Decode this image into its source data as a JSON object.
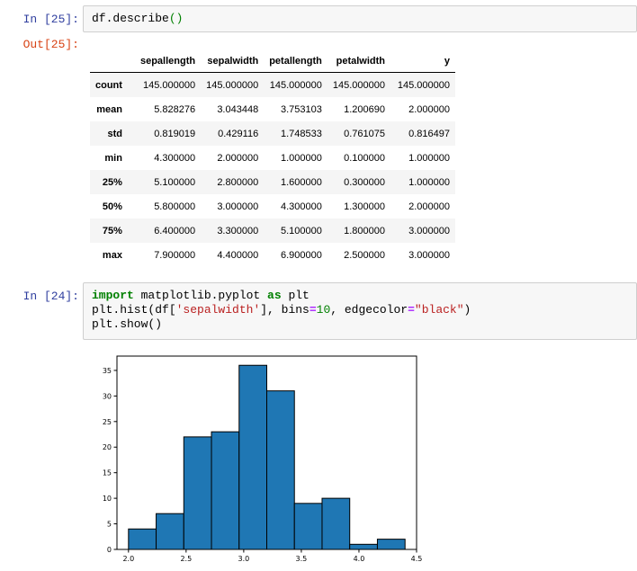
{
  "cell25": {
    "in_prompt": "In [25]:",
    "out_prompt": "Out[25]:",
    "code": {
      "obj": "df.describe",
      "lp": "(",
      "rp": ")"
    }
  },
  "describe_table": {
    "columns": [
      "sepallength",
      "sepalwidth",
      "petallength",
      "petalwidth",
      "y"
    ],
    "rows": [
      {
        "label": "count",
        "values": [
          "145.000000",
          "145.000000",
          "145.000000",
          "145.000000",
          "145.000000"
        ]
      },
      {
        "label": "mean",
        "values": [
          "5.828276",
          "3.043448",
          "3.753103",
          "1.200690",
          "2.000000"
        ]
      },
      {
        "label": "std",
        "values": [
          "0.819019",
          "0.429116",
          "1.748533",
          "0.761075",
          "0.816497"
        ]
      },
      {
        "label": "min",
        "values": [
          "4.300000",
          "2.000000",
          "1.000000",
          "0.100000",
          "1.000000"
        ]
      },
      {
        "label": "25%",
        "values": [
          "5.100000",
          "2.800000",
          "1.600000",
          "0.300000",
          "1.000000"
        ]
      },
      {
        "label": "50%",
        "values": [
          "5.800000",
          "3.000000",
          "4.300000",
          "1.300000",
          "2.000000"
        ]
      },
      {
        "label": "75%",
        "values": [
          "6.400000",
          "3.300000",
          "5.100000",
          "1.800000",
          "3.000000"
        ]
      },
      {
        "label": "max",
        "values": [
          "7.900000",
          "4.400000",
          "6.900000",
          "2.500000",
          "3.000000"
        ]
      }
    ]
  },
  "cell24": {
    "in_prompt": "In [24]:",
    "line1": {
      "kw_import": "import",
      "module": " matplotlib.pyplot ",
      "kw_as": "as",
      "alias": " plt"
    },
    "line2": {
      "pre": "plt.hist(df[",
      "str1": "'sepalwidth'",
      "mid": "], bins",
      "eq1": "=",
      "num": "10",
      "mid2": ", edgecolor",
      "eq2": "=",
      "str2": "\"black\"",
      "post": ")"
    },
    "line3": "plt.show()"
  },
  "chart_data": {
    "type": "bar",
    "bin_edges": [
      2.0,
      2.24,
      2.48,
      2.72,
      2.96,
      3.2,
      3.44,
      3.68,
      3.92,
      4.16,
      4.4
    ],
    "values": [
      4,
      7,
      22,
      23,
      36,
      31,
      9,
      10,
      1,
      2
    ],
    "xlim": [
      1.9,
      4.5
    ],
    "ylim": [
      0,
      37.8
    ],
    "xticks": [
      "2.0",
      "2.5",
      "3.0",
      "3.5",
      "4.0",
      "4.5"
    ],
    "xtick_values": [
      2.0,
      2.5,
      3.0,
      3.5,
      4.0,
      4.5
    ],
    "yticks": [
      "0",
      "5",
      "10",
      "15",
      "20",
      "25",
      "30",
      "35"
    ],
    "ytick_values": [
      0,
      5,
      10,
      15,
      20,
      25,
      30,
      35
    ],
    "bar_color": "#1f77b4",
    "edge_color": "#000000"
  }
}
